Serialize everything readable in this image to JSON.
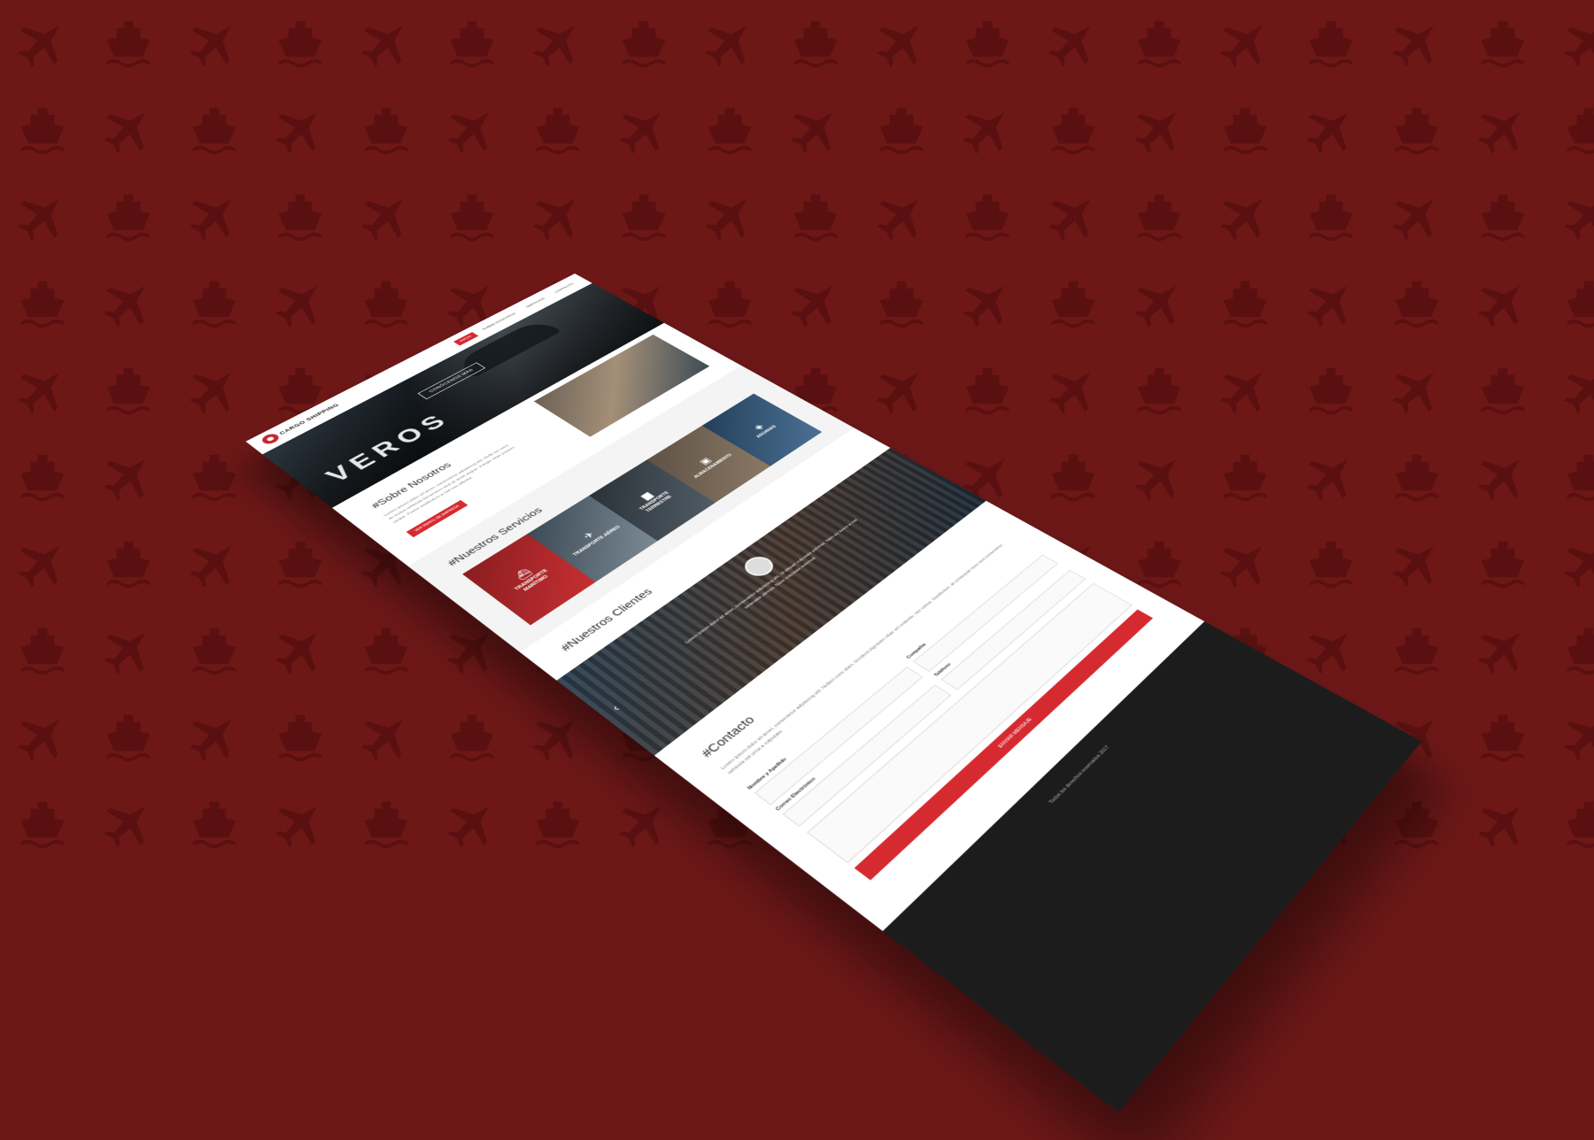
{
  "colors": {
    "background": "#6e1717",
    "accent": "#d62a31",
    "footer": "#1c1c1c"
  },
  "background_icons": [
    "airplane-icon",
    "ship-icon"
  ],
  "nav": {
    "logo_text": "CARGO SHIPPING",
    "items": [
      "INICIO",
      "SOBRE NOSOTROS",
      "SERVICIOS",
      "CONTACTO"
    ]
  },
  "hero": {
    "title": "VEROS",
    "button_label": "CONÓCENOS MÁS"
  },
  "about": {
    "title": "#Sobre Nosotros",
    "text": "Lorem ipsum dolor sit amet, consectetur adipiscing elit. Nulla vel nunc ac lectus vehicula fermentum sed sit amet augue. Integer vitae pretium neque. Fusce vestibulum a nisl nec efficitur.",
    "button_label": "VER PERFIL DE EMPRESA"
  },
  "services": {
    "title": "#Nuestros Servicios",
    "items": [
      {
        "label": "TRANSPORTE MARÍTIMO",
        "icon": "ship-icon"
      },
      {
        "label": "TRANSPORTE AÉREO",
        "icon": "airplane-icon"
      },
      {
        "label": "TRANSPORTE TERRESTRE",
        "icon": "truck-icon"
      },
      {
        "label": "ALMACENAMIENTO",
        "icon": "warehouse-icon"
      },
      {
        "label": "ADUANAS",
        "icon": "customs-icon"
      }
    ]
  },
  "clients": {
    "title": "#Nuestros Clientes",
    "quote": "Lorem ipsum dolor sit amet, consectetur adipiscing elit. Ut aliquet vulputate pulvinar. Nam eu lorem a nisi venenatis ultrices. Nunc vulputate euismod."
  },
  "contact": {
    "title": "#Contacto",
    "text": "Lorem ipsum dolor sit amet, consectetur adipiscing elit. Nullam nunc diam, tincidunt dignissim vitae vel molestie, nec varius. Vestibulum, at consequat nunc sed consectetur, vehicula vel urna a vulputate.",
    "fields": {
      "name": "Nombre y Apellido",
      "company": "Compañía",
      "email": "Correo Electrónico",
      "phone": "Teléfono"
    },
    "submit_label": "ENVIAR MENSAJE"
  },
  "footer": {
    "text": "Todos los derechos reservados 2017"
  }
}
